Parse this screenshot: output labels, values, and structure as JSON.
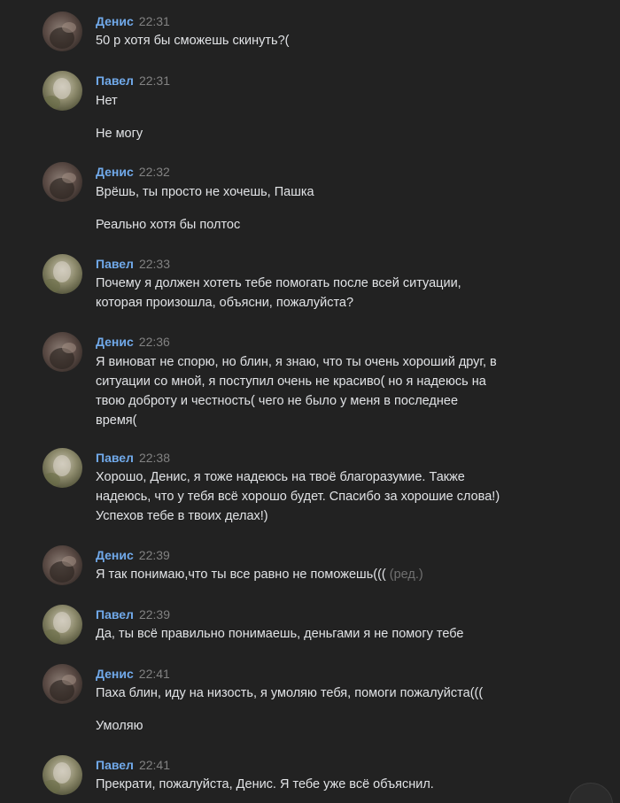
{
  "messages": [
    {
      "author": "Денис",
      "time": "22:31",
      "lines": [
        "50 р хотя бы сможешь скинуть?("
      ]
    },
    {
      "author": "Павел",
      "time": "22:31",
      "lines": [
        "Нет",
        "Не могу"
      ]
    },
    {
      "author": "Денис",
      "time": "22:32",
      "lines": [
        "Врёшь, ты просто не хочешь, Пашка",
        "Реально хотя бы полтос"
      ]
    },
    {
      "author": "Павел",
      "time": "22:33",
      "lines": [
        "Почему я должен хотеть тебе помогать после всей ситуации,",
        "которая произошла, объясни, пожалуйста?"
      ]
    },
    {
      "author": "Денис",
      "time": "22:36",
      "lines": [
        "Я виноват не спорю, но блин, я знаю, что ты очень хороший друг, в",
        "ситуации со мной, я поступил очень не красиво( но я надеюсь на",
        "твою доброту и честность( чего не было у меня в последнее",
        "время("
      ]
    },
    {
      "author": "Павел",
      "time": "22:38",
      "lines": [
        "Хорошо, Денис, я тоже надеюсь на твоё благоразумие. Также",
        "надеюсь, что у тебя всё хорошо будет. Спасибо за хорошие слова!)",
        "Успехов тебе в твоих делах!)"
      ]
    },
    {
      "author": "Денис",
      "time": "22:39",
      "lines": [
        "Я так понимаю,что ты все равно не поможешь((("
      ],
      "edited": "(ред.)"
    },
    {
      "author": "Павел",
      "time": "22:39",
      "lines": [
        "Да, ты всё правильно понимаешь, деньгами я не помогу тебе"
      ]
    },
    {
      "author": "Денис",
      "time": "22:41",
      "lines": [
        "Паха блин, иду на низость, я умоляю тебя, помоги пожалуйста(((",
        "Умоляю"
      ]
    },
    {
      "author": "Павел",
      "time": "22:41",
      "lines": [
        "Прекрати, пожалуйста, Денис. Я тебе уже всё объяснил."
      ]
    }
  ],
  "colors": {
    "background": "#222222",
    "author": "#71aaeb",
    "time": "#828282",
    "text": "#e1e3e6"
  }
}
